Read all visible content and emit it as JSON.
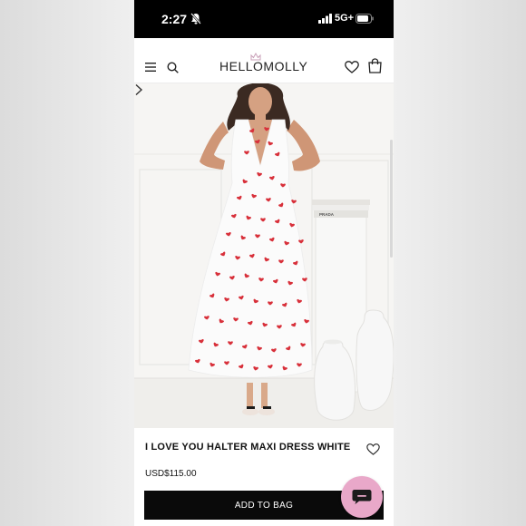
{
  "status_bar": {
    "time": "2:27",
    "network": "5G+",
    "icons": [
      "bell-off-icon",
      "signal-icon",
      "battery-icon"
    ]
  },
  "header": {
    "logo": "HELLOMOLLY",
    "icons": [
      "menu-icon",
      "search-icon",
      "crown-icon",
      "heart-icon",
      "bag-icon"
    ]
  },
  "hero": {
    "book_label": "PRADA",
    "icons": [
      "chevron-right-icon"
    ]
  },
  "product": {
    "title": "I LOVE YOU HALTER MAXI DRESS WHITE",
    "price": "USD$115.00",
    "add_to_bag_label": "ADD TO BAG",
    "icons": [
      "wishlist-heart-icon"
    ]
  },
  "chat": {
    "icon": "chat-icon",
    "color": "#e9a8c9"
  },
  "colors": {
    "status_bar": "#000000",
    "button": "#0a0a0a",
    "accent_heart": "#d8313b",
    "chat_bubble": "#e9a8c9"
  }
}
